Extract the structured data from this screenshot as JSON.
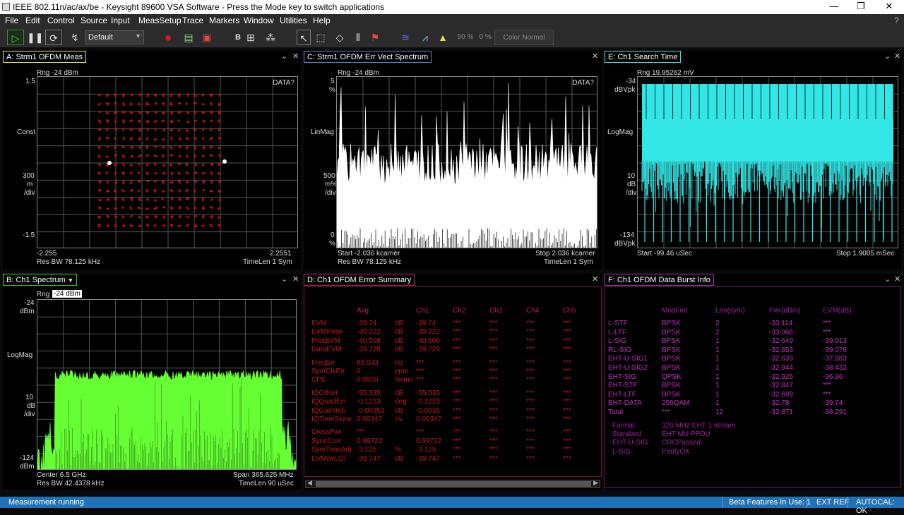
{
  "window": {
    "title": "IEEE 802.11n/ac/ax/be - Keysight 89600 VSA Software - Press the Mode key to switch applications",
    "minimize": "—",
    "restore": "❐",
    "close": "✕"
  },
  "menu": [
    "File",
    "Edit",
    "Control",
    "Source",
    "Input",
    "MeasSetup",
    "Trace",
    "Markers",
    "Window",
    "Utilities",
    "Help"
  ],
  "help_icon": "?",
  "toolbar": {
    "preset": "Default",
    "pct1": "50 %",
    "pct2": "0 %",
    "color_mode": "Color Normal"
  },
  "panes": {
    "a": {
      "title": "A: Strm1 OFDM Meas",
      "range": "Rng -24 dBm",
      "data_flag": "DATA?",
      "y_top": "1.5",
      "y_mid_label": "Const",
      "y_scale": "300",
      "y_scale_unit": "m",
      "y_scale_per": "/div",
      "y_bottom": "-1.5",
      "x_left": "-2.255",
      "x_right": "2.2551",
      "footer_left": "Res BW 78.125 kHz",
      "footer_right": "TimeLen 1  Sym"
    },
    "b": {
      "title": "B: Ch1 Spectrum",
      "range_prefix": "Rng",
      "range_value": "-24 dBm",
      "y_top": "-24",
      "y_top_unit": "dBm",
      "y_mid_label": "LogMag",
      "y_scale": "10",
      "y_scale_unit": "dB",
      "y_scale_per": "/div",
      "y_bottom": "-124",
      "y_bottom_unit": "dBm",
      "x_left": "Center 6.5 GHz",
      "x_right": "Span 365.625 MHz",
      "footer_left": "Res BW 42.4378 kHz",
      "footer_right": "TimeLen 90 uSec"
    },
    "c": {
      "title": "C: Strm1 OFDM Err Vect Spectrum",
      "range": "Rng -24 dBm",
      "data_flag": "DATA?",
      "y_top": "5",
      "y_top_unit": "%",
      "y_mid_label": "LinMag",
      "y_scale": "500",
      "y_scale_unit": "m%",
      "y_scale_per": "/div",
      "y_bottom": "0",
      "y_bottom_unit": "%",
      "x_left": "Start -2.036 kcarrier",
      "x_right": "Stop 2.036 kcarrier",
      "footer_left": "Res BW 78.125 kHz",
      "footer_right": "TimeLen 1  Sym"
    },
    "d": {
      "title": "D: Ch1 OFDM Error Summary",
      "columns": [
        "",
        "Avg",
        "",
        "Ch1",
        "Ch2",
        "Ch3",
        "Ch4",
        "Ch5"
      ],
      "rows": [
        [
          "EVM",
          "-39.74",
          "dB",
          "-39.74",
          "***",
          "***",
          "***",
          "***"
        ],
        [
          "EVMPeak",
          "-30.222",
          "dB",
          "-30.222",
          "***",
          "***",
          "***",
          "***"
        ],
        [
          "PilotEVM",
          "-40.508",
          "dB",
          "-40.508",
          "***",
          "***",
          "***",
          "***"
        ],
        [
          "DataEVM",
          "-39.728",
          "dB",
          "-39.728",
          "***",
          "***",
          "***",
          "***"
        ],
        [
          "FreqErr",
          "80.043",
          "Hz",
          "***",
          "***",
          "***",
          "***",
          "***"
        ],
        [
          "SymClkErr",
          "0",
          "ppm",
          "***",
          "***",
          "***",
          "***",
          "***"
        ],
        [
          "CPE",
          "0.0000",
          "%rms",
          "***",
          "***",
          "***",
          "***",
          "***"
        ],
        [
          "IQOffset",
          "-55.535",
          "dB",
          "-55.535",
          "***",
          "***",
          "***",
          "***"
        ],
        [
          "IQQuadErr",
          "-0.1223",
          "deg",
          "-0.1223",
          "***",
          "***",
          "***",
          "***"
        ],
        [
          "IQGainImb",
          "-0.00353",
          "dB",
          "-0.0035",
          "***",
          "***",
          "***",
          "***"
        ],
        [
          "IQTimeSkew",
          "0.00347",
          "ns",
          "0.00347",
          "***",
          "***",
          "***",
          "***"
        ],
        [
          "CrossPwr",
          "***",
          "",
          "***",
          "***",
          "***",
          "***",
          "***"
        ],
        [
          "SyncCorr",
          "0.99722",
          "",
          "0.99722",
          "***",
          "***",
          "***",
          "***"
        ],
        [
          "SymTimeAdj",
          "-3.125",
          "%",
          "-3.125",
          "***",
          "***",
          "***",
          "***"
        ],
        [
          "EVM(wLO)",
          "-39.747",
          "dB",
          "-39.747",
          "***",
          "***",
          "***",
          "***"
        ]
      ]
    },
    "e": {
      "title": "E: Ch1 Search Time",
      "range": "Rng 19.95262 mV",
      "y_top": "-34",
      "y_top_unit": "dBVpk",
      "y_mid_label": "LogMag",
      "y_scale": "10",
      "y_scale_unit": "dB",
      "y_scale_per": "/div",
      "y_bottom": "-134",
      "y_bottom_unit": "dBVpk",
      "x_left": "Start -99.46 uSec",
      "x_right": "Stop 1.9005 mSec"
    },
    "f": {
      "title": "F: Ch1 OFDM Data Burst Info",
      "columns": [
        "",
        "ModFmt",
        "Len(sym)",
        "Pwr(dBm)",
        "EVM(dB)"
      ],
      "rows": [
        [
          "L-STF",
          "BPSK",
          "2",
          "-33.114",
          "***"
        ],
        [
          "L-LTF",
          "BPSK",
          "2",
          "-33.066",
          "***"
        ],
        [
          "L-SIG",
          "BPSK",
          "1",
          "-32.649",
          "-39.013"
        ],
        [
          "RL-SIG",
          "BPSK",
          "1",
          "-32.653",
          "-39.076"
        ],
        [
          "EHT-U-SIG1",
          "BPSK",
          "1",
          "-32.639",
          "-37.983"
        ],
        [
          "EHT-U-SIG2",
          "BPSK",
          "1",
          "-32.944",
          "-38.432"
        ],
        [
          "EHT-SIG",
          "QPSK",
          "1",
          "-32.925",
          "-36.36"
        ],
        [
          "EHT-STF",
          "BPSK",
          "1",
          "-32.847",
          "***"
        ],
        [
          "EHT-LTF",
          "BPSK",
          "1",
          "-32.699",
          "***"
        ],
        [
          "EHT-DATA",
          "256QAM",
          "1",
          "-32.78",
          "-39.74"
        ],
        [
          "Total",
          "***",
          "12",
          "-32.871",
          "-38.291"
        ]
      ],
      "info": [
        [
          "Format",
          "320  MHz EHT 1  stream"
        ],
        [
          "Standard",
          "EHT MU PPDU"
        ],
        [
          "EHT-U-SIG",
          "CRCPassed"
        ],
        [
          "L-SIG",
          "ParityOK"
        ]
      ]
    }
  },
  "status": {
    "left": "Measurement running",
    "beta": "Beta Features In Use: 1",
    "extref": "EXT REF",
    "autocal": "AUTOCAL: OK"
  },
  "colors": {
    "a": "#e8e83a",
    "b": "#3ad83a",
    "c": "#4a8ad8",
    "d": "#c0186a",
    "e": "#3ae8e8",
    "f": "#b030b0",
    "constellation": "#c01010",
    "spectrum": "#66ff33",
    "search": "#33e6e6"
  }
}
